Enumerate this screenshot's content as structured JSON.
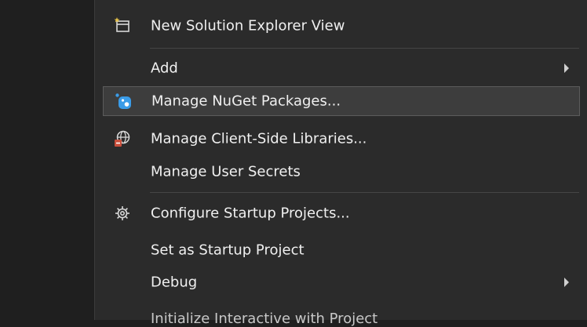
{
  "menu": {
    "items": [
      {
        "label": "New Solution Explorer View",
        "icon": "new-window-icon"
      },
      {
        "label": "Add",
        "submenu": true
      },
      {
        "label": "Manage NuGet Packages...",
        "icon": "nuget-icon",
        "highlighted": true
      },
      {
        "label": "Manage Client-Side Libraries...",
        "icon": "client-libraries-icon"
      },
      {
        "label": "Manage User Secrets"
      },
      {
        "label": "Configure Startup Projects...",
        "icon": "gear-icon"
      },
      {
        "label": "Set as Startup Project"
      },
      {
        "label": "Debug",
        "submenu": true
      }
    ],
    "partial_item": "Initialize Interactive with Project"
  },
  "colors": {
    "menu_bg": "#2b2b2b",
    "highlight_bg": "#3d3d3d",
    "nuget_blue": "#3a9ce8",
    "left_pane_bg": "#1f1f1f"
  }
}
